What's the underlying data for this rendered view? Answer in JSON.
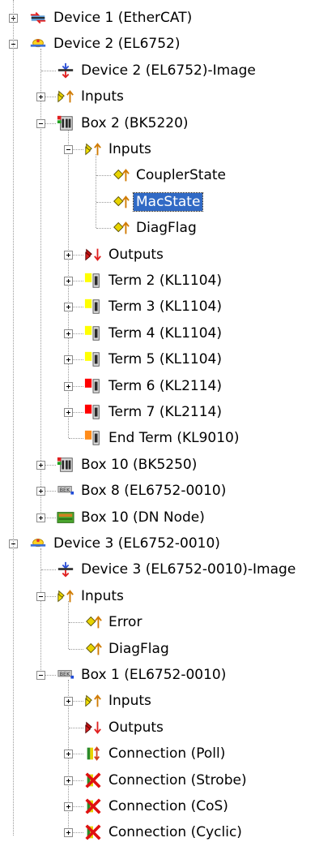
{
  "tree": {
    "rows": [
      {
        "label": "Device 1 (EtherCAT)",
        "level": 0,
        "expander": "plus",
        "icon": "ethercat-device-icon",
        "name": "device-1"
      },
      {
        "label": "Device 2 (EL6752)",
        "level": 0,
        "expander": "minus",
        "icon": "device-icon",
        "name": "device-2"
      },
      {
        "label": "Device 2 (EL6752)-Image",
        "level": 1,
        "expander": "none",
        "icon": "process-image-icon",
        "name": "device-2-image"
      },
      {
        "label": "Inputs",
        "level": 1,
        "expander": "plus",
        "icon": "inputs-icon",
        "name": "device-2-inputs"
      },
      {
        "label": "Box 2 (BK5220)",
        "level": 1,
        "expander": "minus",
        "icon": "bus-coupler-icon",
        "name": "box-2"
      },
      {
        "label": "Inputs",
        "level": 2,
        "expander": "minus",
        "icon": "inputs-icon",
        "name": "box-2-inputs"
      },
      {
        "label": "CouplerState",
        "level": 3,
        "expander": "none",
        "icon": "input-variable-icon",
        "name": "couplerstate"
      },
      {
        "label": "MacState",
        "level": 3,
        "expander": "none",
        "icon": "input-variable-icon",
        "name": "macstate",
        "selected": true
      },
      {
        "label": "DiagFlag",
        "level": 3,
        "expander": "none",
        "icon": "input-variable-icon",
        "name": "box-2-diagflag"
      },
      {
        "label": "Outputs",
        "level": 2,
        "expander": "plus",
        "icon": "outputs-icon",
        "name": "box-2-outputs"
      },
      {
        "label": "Term 2 (KL1104)",
        "level": 2,
        "expander": "plus",
        "icon": "terminal-yellow-icon",
        "name": "term-2"
      },
      {
        "label": "Term 3 (KL1104)",
        "level": 2,
        "expander": "plus",
        "icon": "terminal-yellow-icon",
        "name": "term-3"
      },
      {
        "label": "Term 4 (KL1104)",
        "level": 2,
        "expander": "plus",
        "icon": "terminal-yellow-icon",
        "name": "term-4"
      },
      {
        "label": "Term 5 (KL1104)",
        "level": 2,
        "expander": "plus",
        "icon": "terminal-yellow-icon",
        "name": "term-5"
      },
      {
        "label": "Term 6 (KL2114)",
        "level": 2,
        "expander": "plus",
        "icon": "terminal-red-icon",
        "name": "term-6"
      },
      {
        "label": "Term 7 (KL2114)",
        "level": 2,
        "expander": "plus",
        "icon": "terminal-red-icon",
        "name": "term-7"
      },
      {
        "label": "End Term (KL9010)",
        "level": 2,
        "expander": "none",
        "icon": "terminal-orange-icon",
        "name": "end-term"
      },
      {
        "label": "Box 10 (BK5250)",
        "level": 1,
        "expander": "plus",
        "icon": "bus-coupler-icon",
        "name": "box-10-bk5250"
      },
      {
        "label": "Box 8 (EL6752-0010)",
        "level": 1,
        "expander": "plus",
        "icon": "slave-box-icon",
        "name": "box-8"
      },
      {
        "label": "Box 10 (DN Node)",
        "level": 1,
        "expander": "plus",
        "icon": "dn-node-icon",
        "name": "box-10-dn-node"
      },
      {
        "label": "Device 3 (EL6752-0010)",
        "level": 0,
        "expander": "minus",
        "icon": "device-icon",
        "name": "device-3"
      },
      {
        "label": "Device 3 (EL6752-0010)-Image",
        "level": 1,
        "expander": "none",
        "icon": "process-image-icon",
        "name": "device-3-image"
      },
      {
        "label": "Inputs",
        "level": 1,
        "expander": "minus",
        "icon": "inputs-icon",
        "name": "device-3-inputs"
      },
      {
        "label": "Error",
        "level": 2,
        "expander": "none",
        "icon": "input-variable-icon",
        "name": "error"
      },
      {
        "label": "DiagFlag",
        "level": 2,
        "expander": "none",
        "icon": "input-variable-icon",
        "name": "device-3-diagflag"
      },
      {
        "label": "Box 1 (EL6752-0010)",
        "level": 1,
        "expander": "minus",
        "icon": "slave-box-icon",
        "name": "box-1"
      },
      {
        "label": "Inputs",
        "level": 2,
        "expander": "plus",
        "icon": "inputs-icon",
        "name": "box-1-inputs"
      },
      {
        "label": "Outputs",
        "level": 2,
        "expander": "none",
        "icon": "outputs-icon",
        "name": "box-1-outputs"
      },
      {
        "label": "Connection (Poll)",
        "level": 2,
        "expander": "plus",
        "icon": "connection-icon",
        "name": "connection-poll"
      },
      {
        "label": "Connection (Strobe)",
        "level": 2,
        "expander": "plus",
        "icon": "connection-disabled-icon",
        "name": "connection-strobe"
      },
      {
        "label": "Connection (CoS)",
        "level": 2,
        "expander": "plus",
        "icon": "connection-disabled-icon",
        "name": "connection-cos"
      },
      {
        "label": "Connection (Cyclic)",
        "level": 2,
        "expander": "plus",
        "icon": "connection-disabled-icon",
        "name": "connection-cyclic"
      }
    ]
  },
  "colors": {
    "selection": "#316ac5",
    "treeLine": "#9a9a9a",
    "terminalYellow": "#ffff00",
    "terminalRed": "#ff0000",
    "terminalOrange": "#ff8c1a"
  }
}
